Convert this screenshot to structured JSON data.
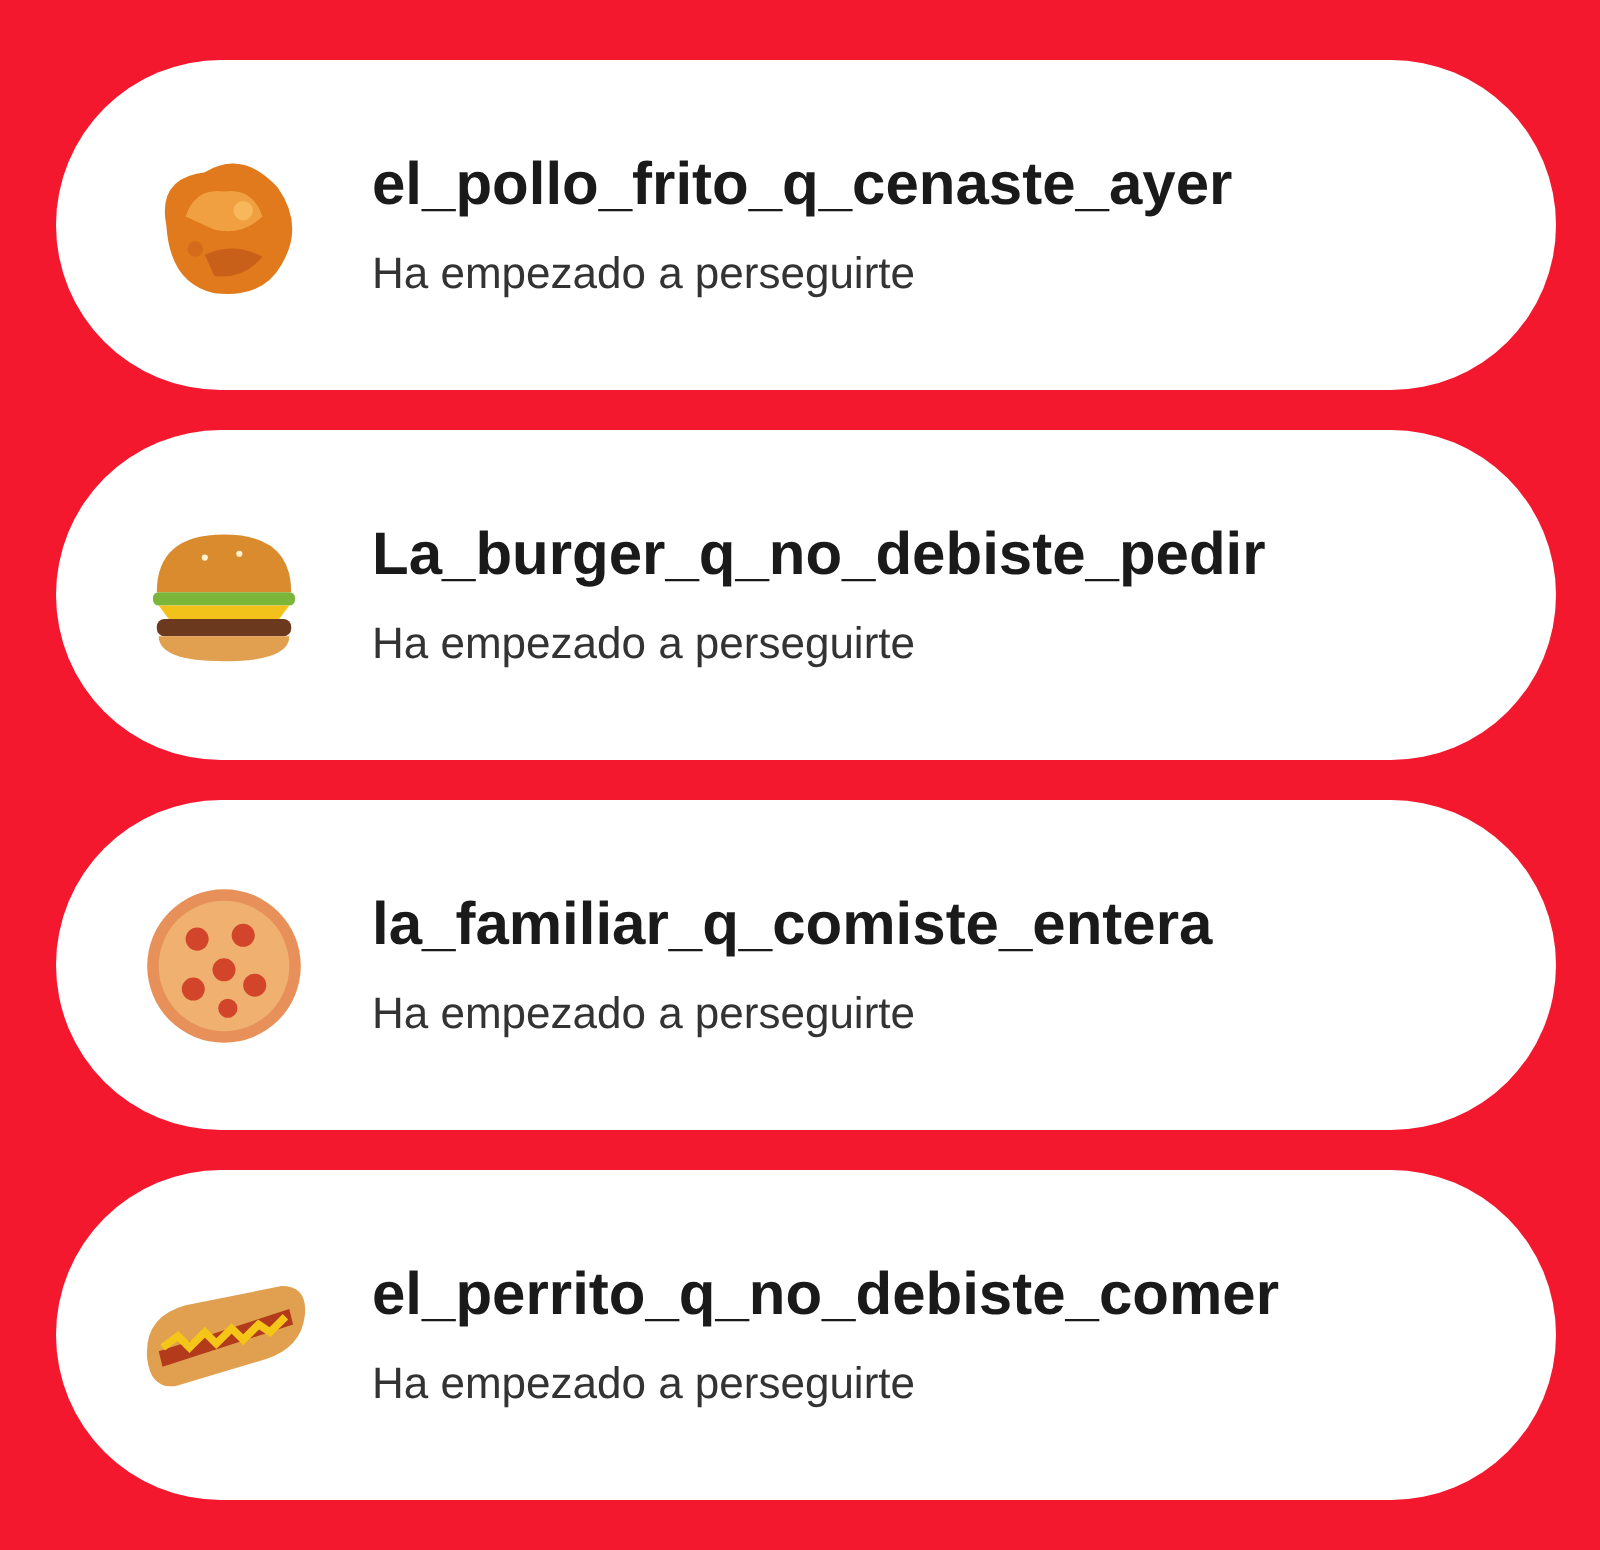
{
  "notifications": [
    {
      "username": "el_pollo_frito_q_cenaste_ayer",
      "message": "Ha empezado a perseguirte"
    },
    {
      "username": "La_burger_q_no_debiste_pedir",
      "message": "Ha empezado a perseguirte"
    },
    {
      "username": "la_familiar_q_comiste_entera",
      "message": "Ha empezado a perseguirte"
    },
    {
      "username": "el_perrito_q_no_debiste_comer",
      "message": "Ha empezado a perseguirte"
    }
  ]
}
